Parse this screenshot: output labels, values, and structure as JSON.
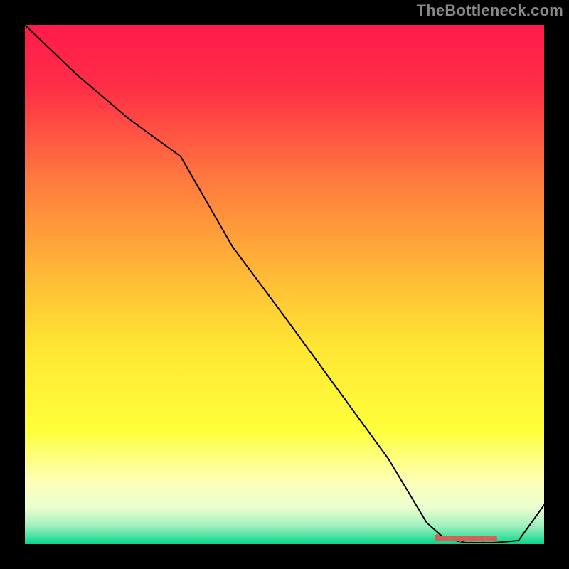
{
  "watermark": "TheBottleneck.com",
  "colors": {
    "gradient_top": "#ff1a4b",
    "gradient_mid1": "#ff803f",
    "gradient_mid2": "#ffd531",
    "gradient_mid3": "#ffff33",
    "gradient_mid4": "#fbffd8",
    "gradient_bottom": "#06d68a",
    "line": "#000000",
    "marker": "#d4605b",
    "background": "#000000"
  },
  "chart_data": {
    "type": "line",
    "title": "",
    "xlabel": "",
    "ylabel": "",
    "x": [
      0.0,
      0.1,
      0.2,
      0.3,
      0.4,
      0.5,
      0.6,
      0.7,
      0.8,
      0.85,
      0.9,
      0.95,
      1.0
    ],
    "y": [
      1.0,
      0.9,
      0.82,
      0.72,
      0.57,
      0.44,
      0.3,
      0.16,
      0.03,
      0.0,
      0.0,
      0.0,
      0.07
    ],
    "xlim": [
      0,
      1
    ],
    "ylim": [
      0,
      1
    ],
    "markers": {
      "x": [
        0.8,
        0.83,
        0.86,
        0.89,
        0.92
      ],
      "y": [
        0.005,
        0.0,
        0.0,
        0.0,
        0.0
      ]
    }
  }
}
